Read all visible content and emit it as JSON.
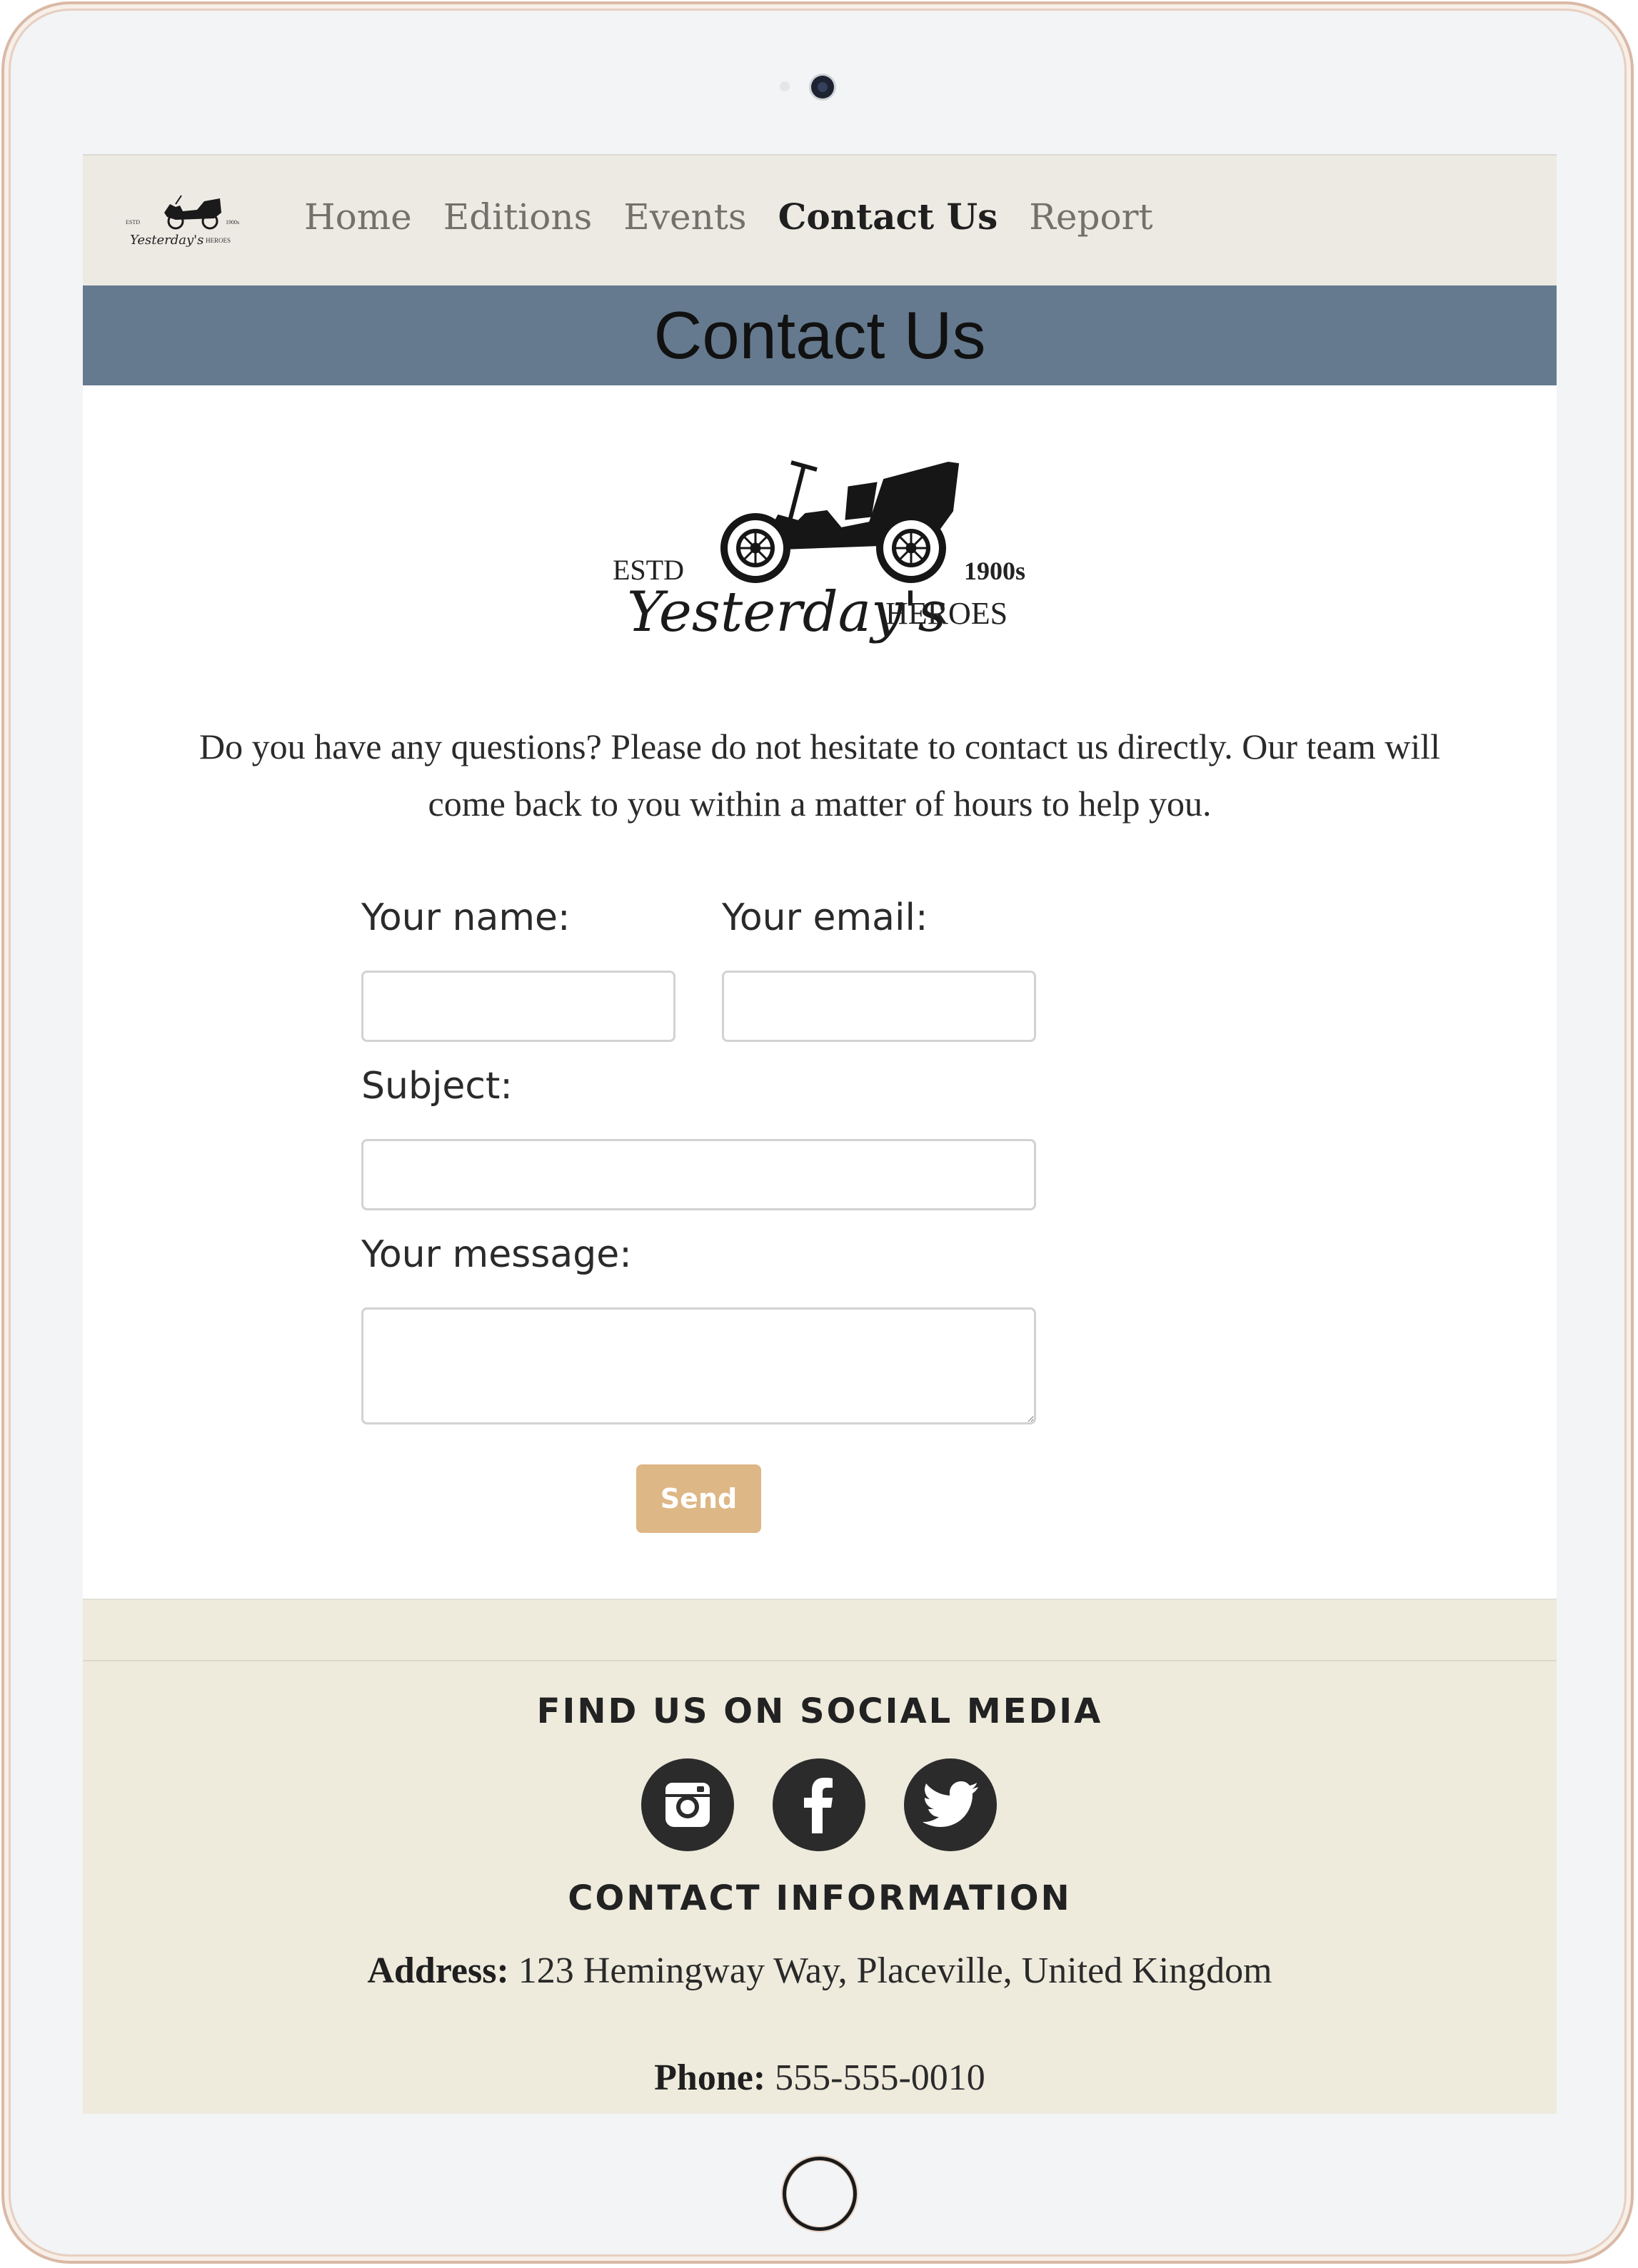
{
  "nav": {
    "logo_alt": "Yesterday's Heroes",
    "links": [
      {
        "label": "Home",
        "active": false
      },
      {
        "label": "Editions",
        "active": false
      },
      {
        "label": "Events",
        "active": false
      },
      {
        "label": "Contact Us",
        "active": true
      },
      {
        "label": "Report",
        "active": false
      }
    ]
  },
  "header": {
    "title": "Contact Us"
  },
  "logo": {
    "estd": "ESTD",
    "year": "1900s",
    "script": "Yesterday's",
    "heroes": "HEROES"
  },
  "intro": "Do you have any questions? Please do not hesitate to contact us directly. Our team will come back to you within a matter of hours to help you.",
  "form": {
    "name_label": "Your name:",
    "name_value": "",
    "email_label": "Your email:",
    "email_value": "",
    "subject_label": "Subject:",
    "subject_value": "",
    "message_label": "Your message:",
    "message_value": "",
    "send_label": "Send"
  },
  "footer": {
    "social_heading": "FIND US ON SOCIAL MEDIA",
    "social_icons": [
      "instagram-icon",
      "facebook-icon",
      "twitter-icon"
    ],
    "contact_heading": "CONTACT INFORMATION",
    "address_label": "Address:",
    "address_value": "123 Hemingway Way, Placeville, United Kingdom",
    "phone_label": "Phone:",
    "phone_value": "555-555-0010"
  },
  "colors": {
    "nav_bg": "#edeae3",
    "title_bar": "#657a8e",
    "send_button": "#deb786",
    "footer_bg": "#eeebdd",
    "social_icon_bg": "#2b2b2b"
  }
}
